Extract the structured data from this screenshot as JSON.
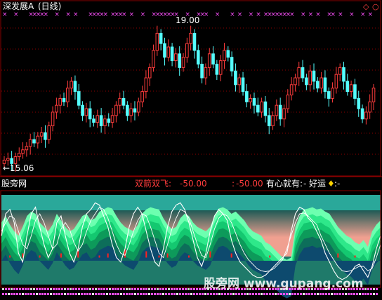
{
  "title": "深发展A",
  "period": "(日线)",
  "icons": [
    "diamond-outline-icon",
    "circle-outline-icon"
  ],
  "price_high_label": "19.00",
  "price_low_label": "←15.06",
  "indicator": {
    "name": "股旁网",
    "field1_label": "双箭双飞:",
    "field1_value": "-50.00",
    "field2_label": ":",
    "field2_value": "-50.00",
    "field3_label": "有心就有:",
    "field3_value": "-",
    "field4_label": "好运",
    "field4_value": ":-"
  },
  "watermark": "股旁网  www.gupang.com",
  "colors": {
    "up": "#ff3c3c",
    "down": "#54ffff",
    "grid": "#8c0000",
    "marker": "#ff50ff",
    "white_line": "#ffffff"
  },
  "chart_data": [
    {
      "type": "candlestick",
      "title": "深发展A (日线)",
      "ylim": [
        14.8,
        19.4
      ],
      "annotations": [
        {
          "text": "19.00",
          "value": 19.0
        },
        {
          "text": "←15.06",
          "value": 15.06
        }
      ],
      "closes": [
        15.2,
        15.25,
        15.1,
        15.3,
        15.4,
        15.5,
        15.6,
        15.8,
        15.7,
        15.9,
        16.0,
        15.8,
        16.2,
        16.6,
        16.8,
        17.0,
        16.9,
        17.3,
        17.5,
        17.2,
        16.8,
        16.5,
        16.7,
        16.4,
        16.3,
        16.5,
        16.2,
        16.4,
        16.3,
        16.5,
        16.8,
        17.0,
        16.8,
        16.5,
        16.7,
        16.6,
        16.9,
        17.2,
        17.6,
        17.9,
        18.4,
        18.9,
        18.6,
        18.2,
        18.5,
        18.1,
        18.3,
        17.9,
        18.2,
        18.6,
        18.9,
        18.4,
        18.0,
        17.6,
        17.9,
        18.3,
        18.0,
        17.7,
        18.1,
        18.4,
        18.2,
        17.8,
        17.4,
        17.6,
        17.2,
        16.9,
        17.0,
        16.8,
        16.6,
        16.9,
        16.5,
        16.2,
        16.5,
        16.8,
        16.4,
        16.7,
        17.1,
        17.4,
        17.6,
        17.9,
        17.6,
        17.4,
        17.8,
        17.5,
        17.3,
        17.6,
        17.2,
        17.0,
        17.3,
        17.7,
        17.9,
        17.5,
        17.2,
        17.4,
        17.0,
        16.7,
        16.4,
        16.6,
        16.9,
        17.3
      ],
      "series": [
        {
          "name": "marker-row",
          "values": [
            1,
            0,
            0,
            1,
            0,
            0,
            0,
            1,
            1,
            1,
            1,
            1,
            0,
            0,
            1,
            0,
            0,
            1,
            0,
            1,
            0,
            0,
            0,
            1,
            1,
            1,
            1,
            1,
            0,
            1,
            1,
            1,
            1,
            0,
            1,
            0,
            0,
            1,
            0,
            0,
            1,
            1,
            1,
            1,
            1,
            1,
            1,
            0,
            0,
            1,
            0,
            0,
            1,
            1,
            1,
            0,
            0,
            1,
            0,
            0,
            0,
            1,
            0,
            1,
            0,
            0,
            1,
            0,
            1,
            0,
            1,
            1,
            1,
            1,
            1,
            1,
            1,
            1,
            0,
            0,
            1,
            0,
            1,
            0,
            1,
            0,
            0,
            1,
            1,
            0,
            1,
            0,
            0,
            1,
            0,
            0,
            1,
            0,
            1,
            0
          ]
        }
      ]
    },
    {
      "type": "area",
      "title": "双箭双飞",
      "ylim": [
        -100,
        100
      ],
      "series": [
        {
          "name": "band",
          "values": [
            40,
            55,
            35,
            20,
            10,
            30,
            55,
            65,
            60,
            40,
            30,
            20,
            35,
            60,
            45,
            30,
            20,
            25,
            40,
            55,
            60,
            45,
            50,
            65,
            70,
            75,
            72,
            55,
            40,
            30,
            25,
            20,
            35,
            60,
            70,
            75,
            72,
            70,
            50,
            35,
            25,
            30,
            50,
            60,
            55,
            40,
            30,
            25,
            20,
            30,
            55,
            72,
            75,
            70,
            60,
            65,
            55,
            45,
            30,
            20,
            15,
            10,
            -5,
            -10,
            -20,
            -30,
            -40,
            -45,
            -40,
            30,
            55,
            70,
            72,
            75,
            70,
            72,
            65,
            60,
            45,
            30,
            20,
            10,
            5,
            -5,
            -10,
            0,
            -15,
            20,
            35,
            45
          ]
        },
        {
          "name": "white1",
          "values": [
            10,
            60,
            70,
            40,
            -30,
            -50,
            10,
            60,
            75,
            30,
            -10,
            -40,
            -20,
            40,
            55,
            10,
            -30,
            -50,
            -20,
            30,
            60,
            70,
            85,
            80,
            55,
            30,
            -10,
            -40,
            -50,
            -20,
            30,
            60,
            75,
            60,
            20,
            -20,
            -50,
            -60,
            -20,
            30,
            65,
            80,
            85,
            70,
            40,
            0,
            -40,
            -60,
            -30,
            20,
            55,
            70,
            60,
            45,
            0,
            -30,
            -50,
            -60,
            -70,
            -80,
            -85,
            -85,
            -80,
            -70,
            -60,
            -50,
            -40,
            -30,
            20,
            60,
            75,
            70,
            50,
            40,
            20,
            0,
            -30,
            -50,
            -70,
            -85,
            -90,
            -85,
            -75,
            -60,
            -55,
            -70,
            -85,
            -60,
            -20,
            10
          ]
        },
        {
          "name": "white2",
          "values": [
            20,
            40,
            55,
            50,
            20,
            -10,
            -20,
            10,
            45,
            60,
            40,
            10,
            -20,
            -10,
            25,
            40,
            25,
            -5,
            -25,
            -10,
            20,
            45,
            60,
            75,
            70,
            50,
            20,
            -10,
            -30,
            -35,
            -10,
            20,
            45,
            60,
            55,
            30,
            0,
            -30,
            -40,
            -10,
            25,
            50,
            70,
            65,
            50,
            20,
            -10,
            -35,
            -40,
            -10,
            25,
            50,
            60,
            55,
            40,
            15,
            -10,
            -30,
            -45,
            -55,
            -65,
            -70,
            -72,
            -70,
            -65,
            -55,
            -45,
            -20,
            10,
            40,
            60,
            62,
            55,
            45,
            35,
            10,
            -10,
            -30,
            -45,
            -60,
            -70,
            -72,
            -70,
            -65,
            -60,
            -60,
            -70,
            -65,
            -40,
            -10
          ]
        },
        {
          "name": "red-bars",
          "values": [
            0,
            0,
            5,
            0,
            0,
            10,
            0,
            0,
            0,
            5,
            0,
            0,
            0,
            0,
            10,
            0,
            0,
            0,
            20,
            0,
            0,
            0,
            0,
            5,
            0,
            10,
            0,
            0,
            0,
            20,
            0,
            0,
            0,
            0,
            15,
            0,
            0,
            5,
            0,
            10,
            0,
            0,
            0,
            0,
            5,
            0,
            0,
            0,
            0,
            15,
            0,
            0,
            0,
            0,
            10,
            0,
            0,
            0,
            0,
            0,
            0,
            0,
            0,
            5,
            0,
            0,
            0,
            0,
            0,
            0,
            0,
            0,
            0,
            0,
            0,
            0,
            0,
            0,
            0,
            10,
            0,
            0,
            0,
            5,
            0,
            0,
            0,
            0,
            0,
            0
          ]
        }
      ]
    }
  ]
}
